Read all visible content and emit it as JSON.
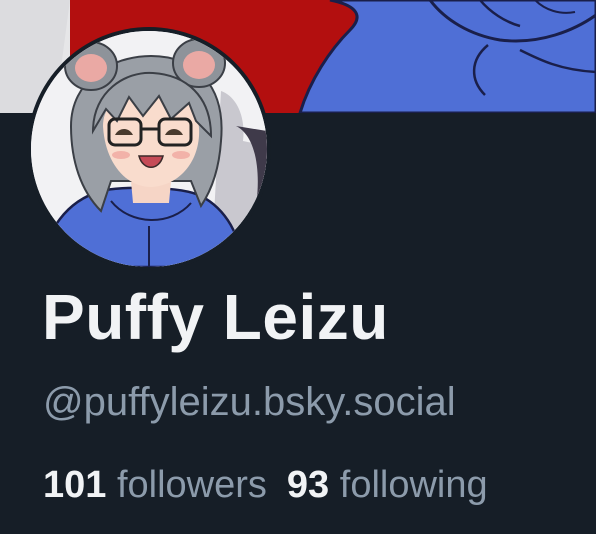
{
  "profile": {
    "display_name": "Puffy Leizu",
    "handle": "@puffyleizu.bsky.social",
    "followers_count": "101",
    "followers_label": "followers",
    "following_count": "93",
    "following_label": "following"
  },
  "colors": {
    "background": "#161e27",
    "banner_red": "#b30f0f",
    "hoodie_blue": "#4f6fd6",
    "name_text": "#f1f3f5",
    "muted_text": "#8c9bab"
  }
}
